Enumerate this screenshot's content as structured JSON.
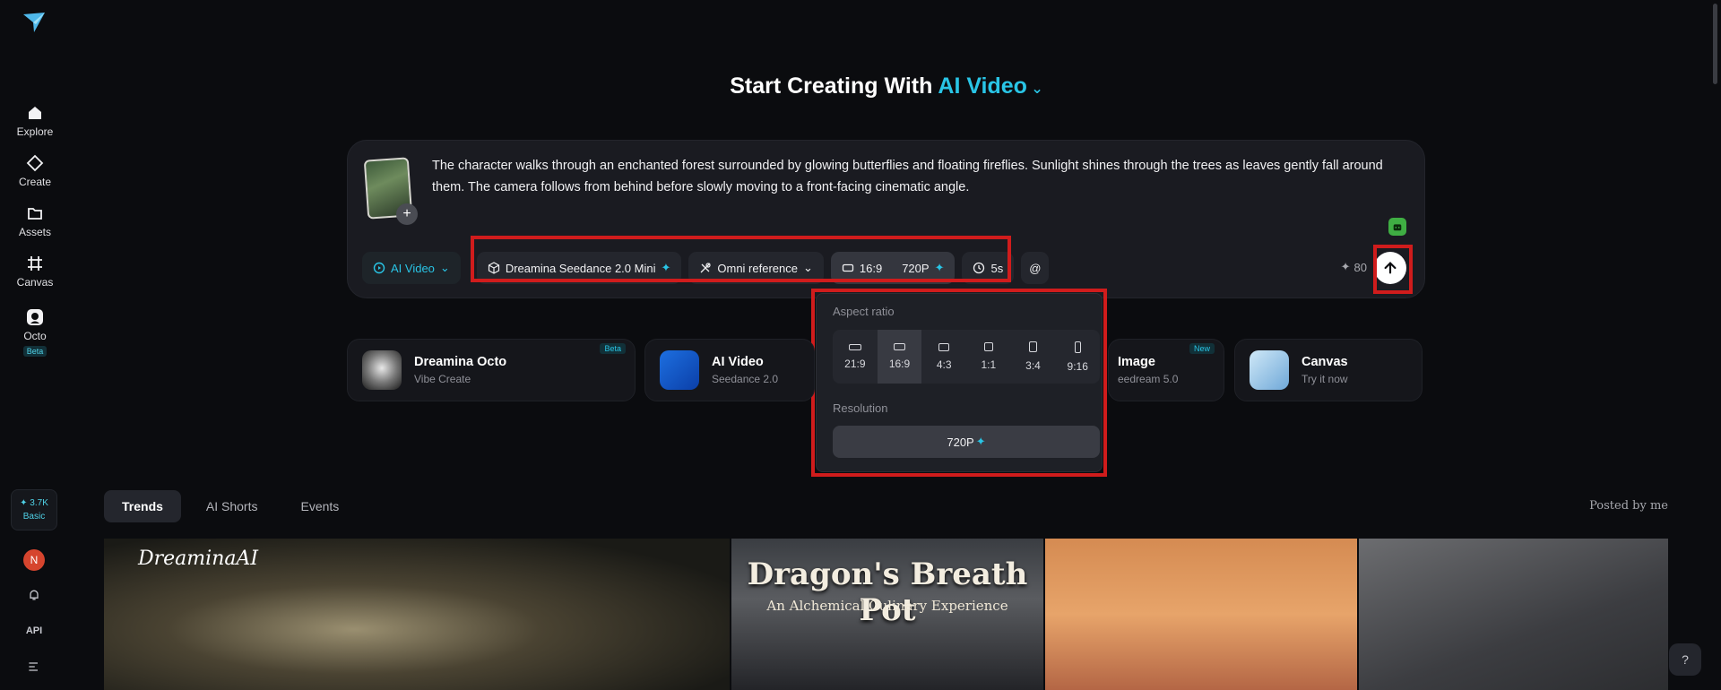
{
  "sidebar": {
    "items": [
      {
        "label": "Explore",
        "icon": "home-icon"
      },
      {
        "label": "Create",
        "icon": "diamond-icon"
      },
      {
        "label": "Assets",
        "icon": "folder-icon"
      },
      {
        "label": "Canvas",
        "icon": "canvas-icon"
      },
      {
        "label": "Octo",
        "icon": "octo-icon",
        "badge": "Beta"
      }
    ],
    "credits": {
      "amount": "3.7K",
      "tier": "Basic"
    },
    "avatar_initial": "N",
    "api_label": "API"
  },
  "headline": {
    "prefix": "Start Creating With",
    "mode": "AI Video"
  },
  "prompt": {
    "text": "The character walks through an enchanted forest surrounded by glowing butterflies and floating fireflies. Sunlight shines through the trees as leaves gently fall around them. The camera follows from behind before slowly moving to a front-facing cinematic angle."
  },
  "toolbar": {
    "mode": "AI Video",
    "model": "Dreamina Seedance 2.0 Mini",
    "reference": "Omni reference",
    "aspect": "16:9",
    "resolution": "720P",
    "duration": "5s",
    "mention": "@",
    "cost": "80"
  },
  "popover": {
    "aspect_title": "Aspect ratio",
    "ratios": [
      "21:9",
      "16:9",
      "4:3",
      "1:1",
      "3:4",
      "9:16"
    ],
    "selected_ratio": "16:9",
    "resolution_title": "Resolution",
    "resolution_value": "720P"
  },
  "features": [
    {
      "name": "Dreamina Octo",
      "sub": "Vibe Create",
      "badge": "Beta"
    },
    {
      "name": "AI Video",
      "sub": "Seedance 2.0",
      "badge": ""
    },
    {
      "name": "Image",
      "sub": "eedream 5.0",
      "badge": "New"
    },
    {
      "name": "Canvas",
      "sub": "Try it now",
      "badge": ""
    }
  ],
  "tabs": [
    "Trends",
    "AI Shorts",
    "Events"
  ],
  "posted_by": "Posted by me",
  "gallery": {
    "brand": "DreaminaAI",
    "card2_title": "Dragon's Breath Pot",
    "card2_sub": "An Alchemical Culinary Experience"
  },
  "colors": {
    "accent": "#29c5e6",
    "highlight": "#d01c1c",
    "background": "#0b0c0f"
  }
}
